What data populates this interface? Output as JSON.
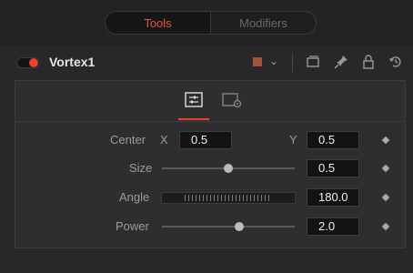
{
  "tabs": {
    "tools_label": "Tools",
    "modifiers_label": "Modifiers"
  },
  "tool": {
    "name": "Vortex1",
    "enabled": true,
    "swatch_color": "#a0553a"
  },
  "header_icons": [
    "subview-icon",
    "pin-icon",
    "lock-icon",
    "reset-icon"
  ],
  "panel_tabs": [
    "controls-tab-icon",
    "settings-tab-icon"
  ],
  "params": {
    "center": {
      "label": "Center",
      "x_label": "X",
      "x_value": "0.5",
      "y_label": "Y",
      "y_value": "0.5"
    },
    "size": {
      "label": "Size",
      "value": "0.5",
      "slider_fraction": 0.5
    },
    "angle": {
      "label": "Angle",
      "value": "180.0"
    },
    "power": {
      "label": "Power",
      "value": "2.0",
      "slider_fraction": 0.58
    }
  },
  "colors": {
    "accent": "#e8442d",
    "background": "#28282a",
    "panel": "#2e2e30"
  }
}
